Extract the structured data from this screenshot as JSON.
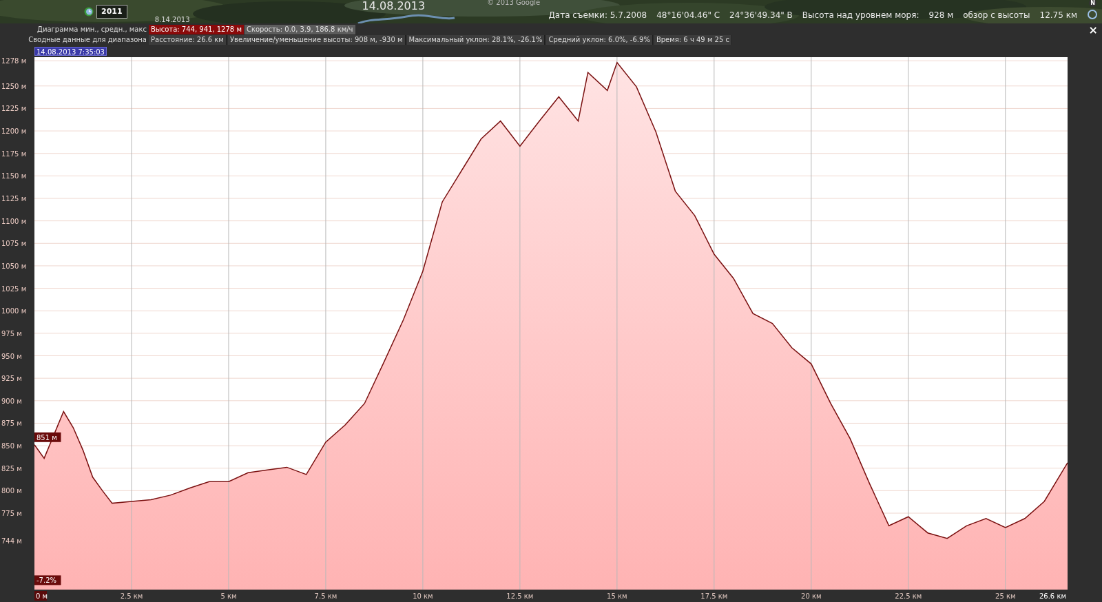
{
  "map_strip": {
    "year_badge": "2011",
    "partial_date": "8.14.2013",
    "date_title": "14.08.2013",
    "copyright": "© 2013 Google",
    "status": [
      "Дата съемки: 5.7.2008",
      "48°16'04.46\" С",
      "24°36'49.34\" В",
      "Высота над уровнем моря:",
      "928 м",
      "обзор с высоты",
      "12.75 км"
    ],
    "compass": "N"
  },
  "profile": {
    "close": "×",
    "chart_selector": {
      "label": "Диаграмма мин., средн., макс",
      "options": [
        {
          "text": "Высота: 744, 941, 1278 м",
          "selected": true
        },
        {
          "text": "Скорость: 0.0, 3.9, 186.8 км/ч",
          "selected": false
        }
      ]
    },
    "summary": {
      "label": "Сводные данные для диапазона",
      "items": [
        "Расстояние: 26.6 км",
        "Увеличение/уменьшение высоты: 908 м, -930 м",
        "Максимальный уклон: 28.1%, -26.1%",
        "Средний уклон: 6.0%, -6.9%",
        "Время: 6 ч 49 м 25 с"
      ]
    },
    "cursor_time": "14.08.2013 7:35:03",
    "chart_data": {
      "type": "area",
      "grid": true,
      "x": [
        0,
        0.25,
        0.75,
        1,
        1.25,
        1.5,
        1.75,
        2,
        2.5,
        3,
        3.5,
        4,
        4.5,
        5,
        5.5,
        6,
        6.5,
        7,
        7.5,
        8,
        8.5,
        9,
        9.5,
        10,
        10.5,
        11,
        11.5,
        12,
        12.5,
        13,
        13.5,
        14,
        14.25,
        14.75,
        15,
        15.5,
        16,
        16.5,
        17,
        17.5,
        18,
        18.5,
        19,
        19.5,
        20,
        20.5,
        21,
        21.5,
        22,
        22.5,
        23,
        23.5,
        24,
        24.5,
        25,
        25.5,
        26,
        26.6
      ],
      "series": [
        {
          "color": "#7a1010",
          "values": [
            851,
            836,
            888,
            870,
            845,
            815,
            800,
            786,
            788,
            790,
            795,
            803,
            810,
            810,
            820,
            823,
            826,
            818,
            854,
            873,
            897,
            943,
            990,
            1044,
            1121,
            1156,
            1191,
            1211,
            1183,
            1211,
            1238,
            1211,
            1265,
            1245,
            1276,
            1249,
            1199,
            1133,
            1106,
            1063,
            1036,
            997,
            986,
            959,
            941,
            897,
            858,
            808,
            761,
            771,
            753,
            747,
            761,
            769,
            759,
            769,
            788,
            831
          ]
        }
      ],
      "xlim": [
        0,
        26.6
      ],
      "ylim": [
        690,
        1282
      ],
      "xticks": [
        {
          "value": 0,
          "label": "0 м"
        },
        {
          "value": 2.5,
          "label": "2.5 км"
        },
        {
          "value": 5,
          "label": "5 км"
        },
        {
          "value": 7.5,
          "label": "7.5 км"
        },
        {
          "value": 10,
          "label": "10 км"
        },
        {
          "value": 12.5,
          "label": "12.5 км"
        },
        {
          "value": 15,
          "label": "15 км"
        },
        {
          "value": 17.5,
          "label": "17.5 км"
        },
        {
          "value": 20,
          "label": "20 км"
        },
        {
          "value": 22.5,
          "label": "22.5 км"
        },
        {
          "value": 25,
          "label": "25 км"
        },
        {
          "value": 26.6,
          "label": "26.6 км"
        }
      ],
      "yticks": [
        {
          "value": 744,
          "label": "744 м"
        },
        {
          "value": 775,
          "label": "775 м"
        },
        {
          "value": 800,
          "label": "800 м"
        },
        {
          "value": 825,
          "label": "825 м"
        },
        {
          "value": 850,
          "label": "850 м"
        },
        {
          "value": 875,
          "label": "875 м"
        },
        {
          "value": 900,
          "label": "900 м"
        },
        {
          "value": 925,
          "label": "925 м"
        },
        {
          "value": 950,
          "label": "950 м"
        },
        {
          "value": 975,
          "label": "975 м"
        },
        {
          "value": 1000,
          "label": "1000 м"
        },
        {
          "value": 1025,
          "label": "1025 м"
        },
        {
          "value": 1050,
          "label": "1050 м"
        },
        {
          "value": 1075,
          "label": "1075 м"
        },
        {
          "value": 1100,
          "label": "1100 м"
        },
        {
          "value": 1125,
          "label": "1125 м"
        },
        {
          "value": 1150,
          "label": "1150 м"
        },
        {
          "value": 1175,
          "label": "1175 м"
        },
        {
          "value": 1200,
          "label": "1200 м"
        },
        {
          "value": 1225,
          "label": "1225 м"
        },
        {
          "value": 1250,
          "label": "1250 м"
        },
        {
          "value": 1278,
          "label": "1278 м"
        }
      ],
      "annotations": [
        {
          "text": "851 м",
          "x": 0,
          "y": 851
        },
        {
          "text": "-7.2%",
          "x": 0,
          "y": 692
        }
      ]
    }
  }
}
